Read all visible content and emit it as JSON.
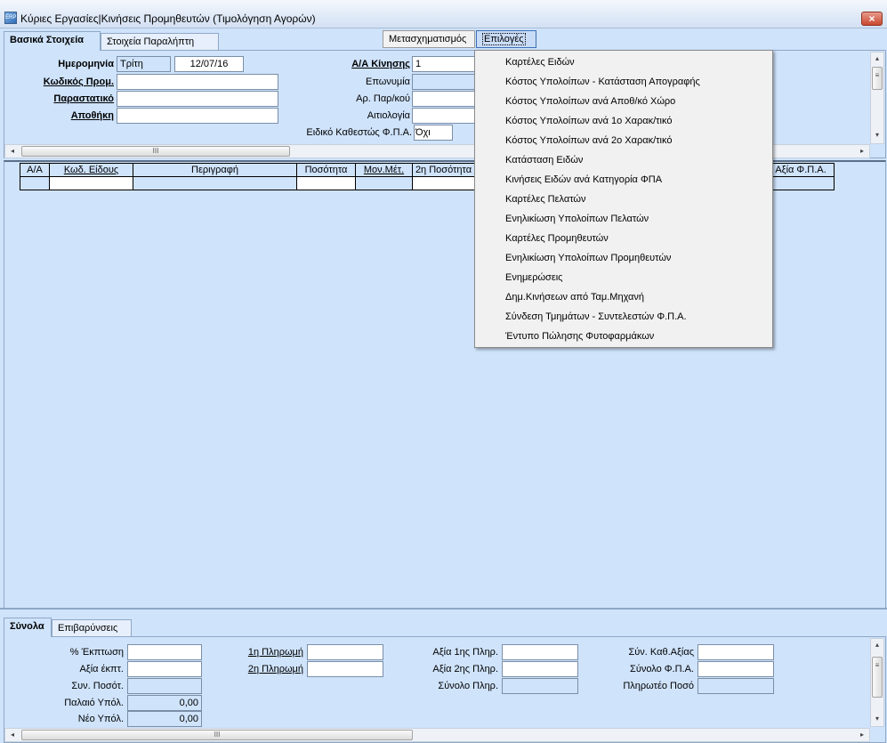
{
  "window": {
    "title": "Κύριες Εργασίες|Κινήσεις Προμηθευτών (Τιμολόγηση Αγορών)",
    "close": "×",
    "icon_label": "ERP"
  },
  "top_tabs": [
    "Βασικά Στοιχεία",
    "Στοιχεία Παραλήπτη"
  ],
  "toolbar": {
    "transform": "Μετασχηματισμός",
    "options": "Επιλογές"
  },
  "header_form": {
    "date_label": "Ημερομηνία",
    "day_value": "Τρίτη",
    "date_value": "12/07/16",
    "supplier_code_label": "Κωδικός Προμ.",
    "supplier_code_value": "",
    "document_label": "Παραστατικό",
    "document_value": "",
    "warehouse_label": "Αποθήκη",
    "warehouse_value": "",
    "movement_no_label": "Α/Α Κίνησης",
    "movement_no_value": "1",
    "name_label": "Επωνυμία",
    "name_value": "",
    "doc_no_label": "Αρ. Παρ/κού",
    "doc_no_value": "",
    "reason_label": "Αιτιολογία",
    "reason_value": "",
    "vat_regime_label": "Ειδικό Καθεστώς Φ.Π.Α.",
    "vat_regime_value": "Όχι"
  },
  "grid": {
    "columns": [
      "Α/Α",
      "Κωδ. Είδους",
      "Περιγραφή",
      "Ποσότητα",
      "Μον.Μέτ.",
      "2η Ποσότητα",
      "Αξία Φ.Π.Α."
    ]
  },
  "menu": {
    "items": [
      "Καρτέλες Ειδών",
      "Κόστος Υπολοίπων - Κατάσταση Απογραφής",
      "Κόστος Υπολοίπων ανά Αποθ/κό Χώρο",
      "Κόστος Υπολοίπων ανά 1ο Χαρακ/τικό",
      "Κόστος Υπολοίπων ανά 2ο Χαρακ/τικό",
      "Κατάσταση Ειδών",
      "Κινήσεις Ειδών ανά Κατηγορία ΦΠΑ",
      "Καρτέλες Πελατών",
      "Ενηλικίωση Υπολοίπων Πελατών",
      "Καρτέλες Προμηθευτών",
      "Ενηλικίωση Υπολοίπων Προμηθευτών",
      "Ενημερώσεις",
      "Δημ.Κινήσεων από Ταμ.Μηχανή",
      "Σύνδεση Τμημάτων - Συντελεστών Φ.Π.Α.",
      "Έντυπο Πώλησης Φυτοφαρμάκων"
    ]
  },
  "bottom_tabs": [
    "Σύνολα",
    "Επιβαρύνσεις"
  ],
  "totals": {
    "discount_pct_label": "% Έκπτωση",
    "discount_pct_value": "",
    "discount_value_label": "Αξία έκπτ.",
    "discount_value_value": "",
    "total_qty_label": "Συν. Ποσότ.",
    "total_qty_value": "",
    "old_balance_label": "Παλαιό Υπόλ.",
    "old_balance_value": "0,00",
    "new_balance_label": "Νέο Υπόλ.",
    "new_balance_value": "0,00",
    "payment1_label": "1η Πληρωμή",
    "payment1_value": "",
    "payment2_label": "2η Πληρωμή",
    "payment2_value": "",
    "payment1_amount_label": "Αξία 1ης Πληρ.",
    "payment1_amount_value": "",
    "payment2_amount_label": "Αξία 2ης Πληρ.",
    "payment2_amount_value": "",
    "payments_total_label": "Σύνολο Πληρ.",
    "payments_total_value": "",
    "net_total_label": "Σύν. Καθ.Αξίας",
    "net_total_value": "",
    "vat_total_label": "Σύνολο Φ.Π.Α.",
    "vat_total_value": "",
    "payable_label": "Πληρωτέο  Ποσό",
    "payable_value": ""
  },
  "icons": {
    "scroll_left": "◂",
    "scroll_right": "▸",
    "scroll_up": "▴",
    "scroll_down": "▾",
    "grip_h": "III",
    "grip_v": "≡"
  }
}
